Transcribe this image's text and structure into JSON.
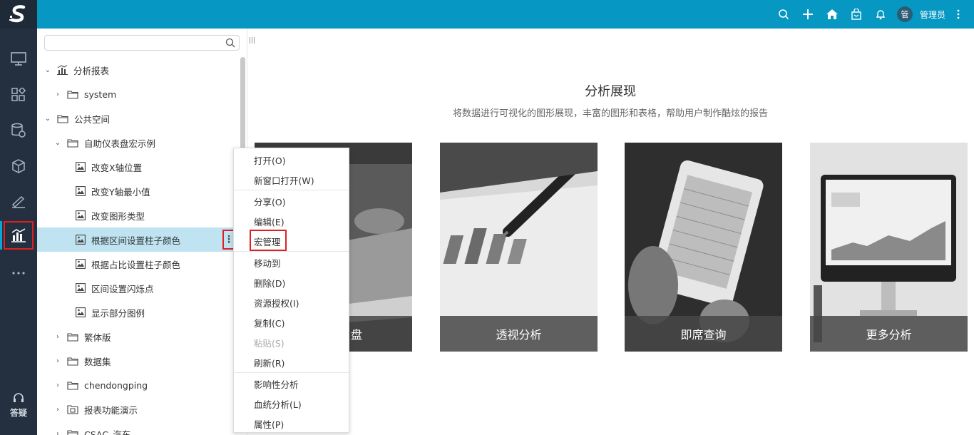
{
  "topbar": {
    "avatar_text": "管",
    "username": "管理员"
  },
  "leftnav": {
    "help_label": "答疑",
    "items": [
      "monitor-icon",
      "dashboard-icon",
      "database-gear-icon",
      "cube-icon",
      "drawing-icon",
      "analysis-report-icon",
      "more-icon"
    ]
  },
  "tree": {
    "search_placeholder": "",
    "rows": [
      {
        "label": "分析报表"
      },
      {
        "label": "system"
      },
      {
        "label": "公共空间"
      },
      {
        "label": "自助仪表盘宏示例"
      },
      {
        "label": "改变X轴位置"
      },
      {
        "label": "改变Y轴最小值"
      },
      {
        "label": "改变图形类型"
      },
      {
        "label": "根据区间设置柱子颜色"
      },
      {
        "label": "根据占比设置柱子颜色"
      },
      {
        "label": "区间设置闪烁点"
      },
      {
        "label": "显示部分图例"
      },
      {
        "label": "繁体版"
      },
      {
        "label": "数据集"
      },
      {
        "label": "chendongping"
      },
      {
        "label": "报表功能演示"
      },
      {
        "label": "CSAC_汽车"
      }
    ],
    "more_label": "⋮"
  },
  "context_menu": {
    "items": [
      {
        "label": "打开(O)"
      },
      {
        "label": "新窗口打开(W)"
      },
      {
        "label": "分享(O)"
      },
      {
        "label": "编辑(E)"
      },
      {
        "label": "宏管理"
      },
      {
        "label": "移动到"
      },
      {
        "label": "删除(D)"
      },
      {
        "label": "资源授权(I)"
      },
      {
        "label": "复制(C)"
      },
      {
        "label": "粘贴(S)"
      },
      {
        "label": "刷新(R)"
      },
      {
        "label": "影响性分析"
      },
      {
        "label": "血统分析(L)"
      },
      {
        "label": "属性(P)"
      }
    ]
  },
  "main": {
    "title": "分析展现",
    "subtitle": "将数据进行可视化的图形展现，丰富的图形和表格，帮助用户制作酷炫的报告",
    "cards": [
      {
        "caption": "盘"
      },
      {
        "caption": "透视分析"
      },
      {
        "caption": "即席查询"
      },
      {
        "caption": "更多分析"
      }
    ]
  },
  "colors": {
    "topbar": "#0697c2",
    "leftnav": "#243040",
    "selected_row": "#bfe3f0",
    "highlight_border": "#e02020"
  }
}
